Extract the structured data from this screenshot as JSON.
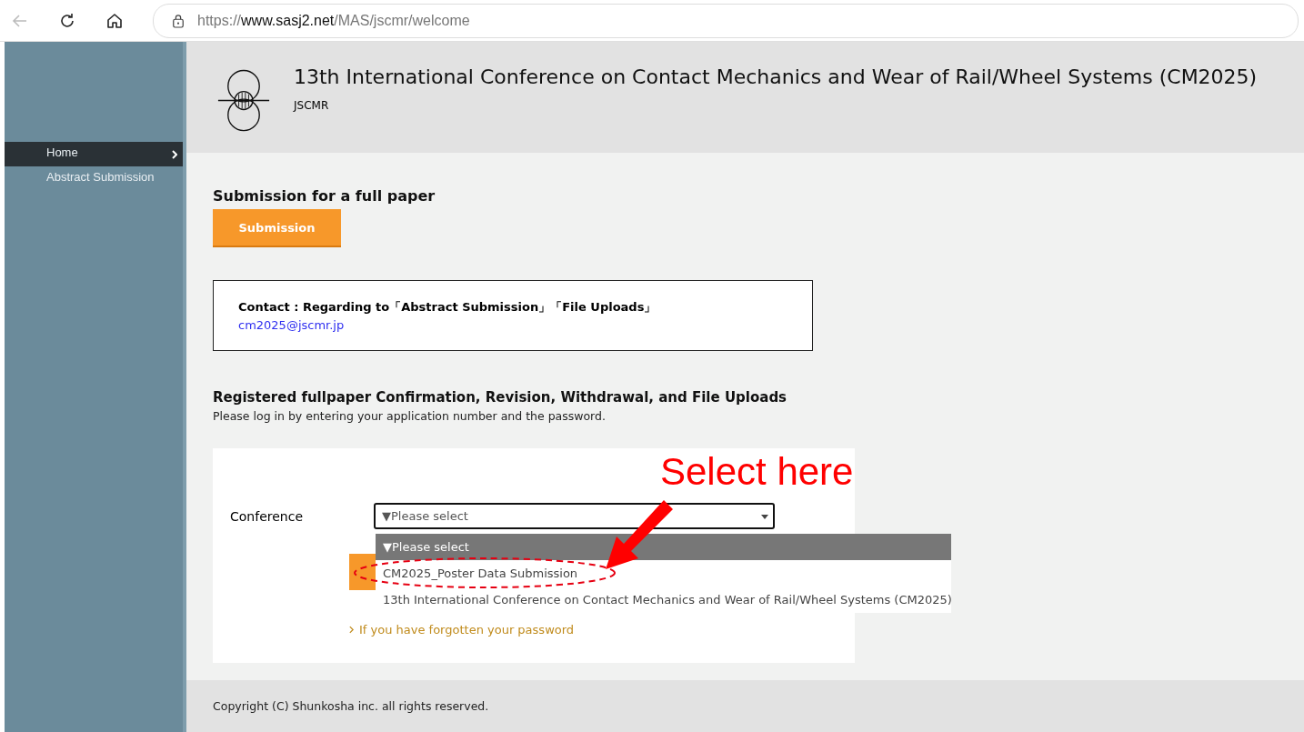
{
  "browser": {
    "url": {
      "scheme": "https://",
      "host": "www.sasj2.net",
      "path": "/MAS/jscmr/welcome"
    }
  },
  "header": {
    "title": "13th International Conference on Contact Mechanics and Wear of Rail/Wheel Systems (CM2025)",
    "subtitle": "JSCMR"
  },
  "sidebar": {
    "items": [
      {
        "label": "Home",
        "selected": true
      },
      {
        "label": "Abstract Submission",
        "selected": false
      }
    ]
  },
  "full_paper": {
    "heading": "Submission for a full paper",
    "button": "Submission"
  },
  "contact": {
    "text": "Contact : Regarding to「Abstract Submission」「File Uploads」",
    "email": "cm2025@jscmr.jp"
  },
  "login": {
    "heading": "Registered fullpaper Confirmation, Revision, Withdrawal, and File Uploads",
    "instructions": "Please log in by entering your application number and the password.",
    "conference_label": "Conference",
    "select_value": "▼Please select",
    "dropdown": [
      {
        "label": "▼Please select",
        "selected": true,
        "circled": false
      },
      {
        "label": "CM2025_Poster Data Submission",
        "selected": false,
        "circled": true
      },
      {
        "label": "13th International Conference on Contact Mechanics and Wear of Rail/Wheel Systems (CM2025)",
        "selected": false,
        "circled": false
      }
    ],
    "forgot_link": "If you have forgotten your password"
  },
  "annotation": {
    "callout": "Select here"
  },
  "footer": {
    "copyright": "Copyright (C) Shunkosha inc. all rights reserved."
  }
}
